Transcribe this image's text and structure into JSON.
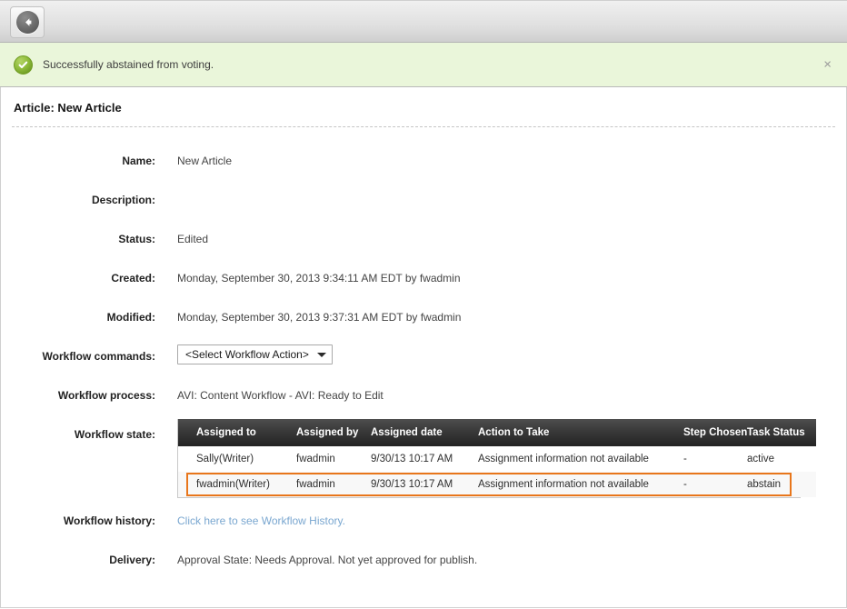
{
  "toolbar": {
    "back_label": "Back",
    "back_icon": "arrow-left-icon"
  },
  "notice": {
    "icon": "success-check-icon",
    "message": "Successfully abstained from voting.",
    "close_label": "×"
  },
  "page": {
    "title": "Article: New Article"
  },
  "fields": {
    "name_label": "Name:",
    "name_value": "New Article",
    "description_label": "Description:",
    "description_value": "",
    "status_label": "Status:",
    "status_value": "Edited",
    "created_label": "Created:",
    "created_value": "Monday, September 30, 2013 9:34:11 AM EDT by fwadmin",
    "modified_label": "Modified:",
    "modified_value": "Monday, September 30, 2013 9:37:31 AM EDT by fwadmin",
    "workflow_commands_label": "Workflow commands:",
    "workflow_commands_value": "<Select Workflow Action>",
    "workflow_process_label": "Workflow process:",
    "workflow_process_value": "AVI: Content Workflow - AVI: Ready to Edit",
    "workflow_state_label": "Workflow state:",
    "workflow_history_label": "Workflow history:",
    "workflow_history_link": "Click here to see Workflow History.",
    "delivery_label": "Delivery:",
    "delivery_value": "Approval State: Needs Approval. Not yet approved for publish."
  },
  "workflow_table": {
    "columns": [
      "Assigned to",
      "Assigned by",
      "Assigned date",
      "Action to Take",
      "Step Chosen",
      "Task Status"
    ],
    "rows": [
      {
        "assigned_to": "Sally(Writer)",
        "assigned_by": "fwadmin",
        "assigned_date": "9/30/13 10:17 AM",
        "action_to_take": "Assignment information not available",
        "step_chosen": "-",
        "task_status": "active",
        "highlighted": false
      },
      {
        "assigned_to": "fwadmin(Writer)",
        "assigned_by": "fwadmin",
        "assigned_date": "9/30/13 10:17 AM",
        "action_to_take": "Assignment information not available",
        "step_chosen": "-",
        "task_status": "abstain",
        "highlighted": true
      }
    ]
  },
  "colors": {
    "notice_bg": "#eaf6da",
    "highlight_border": "#e8761b",
    "link": "#7aa7d0",
    "table_header_bg": "#232323"
  }
}
